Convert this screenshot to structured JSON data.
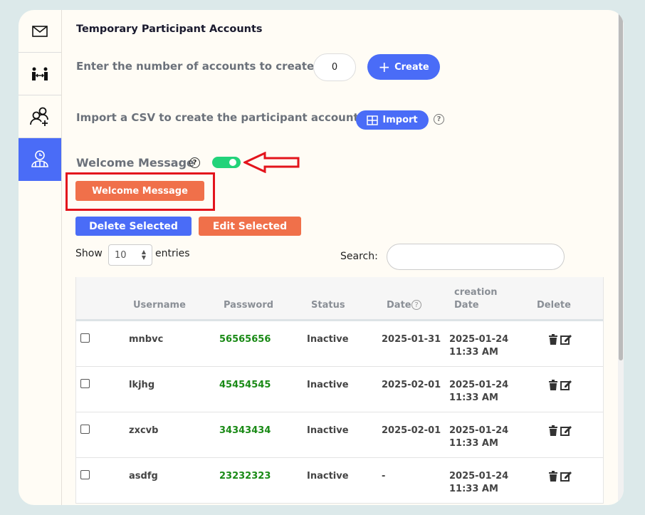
{
  "sidebar": {
    "items": [
      {
        "icon": "mail-icon"
      },
      {
        "icon": "people-exchange-icon"
      },
      {
        "icon": "add-user-icon"
      },
      {
        "icon": "clock-group-icon",
        "active": true
      }
    ]
  },
  "title": "Temporary Participant Accounts",
  "create": {
    "label": "Enter the number of accounts to create",
    "value": "0",
    "button": "Create"
  },
  "import": {
    "label": "Import a CSV to create the participant account.",
    "button": "Import"
  },
  "welcome": {
    "label": "Welcome Message",
    "toggle_on": true,
    "button": "Welcome Message"
  },
  "actions": {
    "delete": "Delete Selected",
    "edit": "Edit Selected"
  },
  "entries": {
    "show": "Show",
    "value": "10",
    "suffix": "entries"
  },
  "search": {
    "label": "Search:",
    "value": ""
  },
  "table": {
    "headers": {
      "username": "Username",
      "password": "Password",
      "status": "Status",
      "date": "Date",
      "creation1": "creation",
      "creation2": "Date",
      "delete": "Delete"
    },
    "rows": [
      {
        "username": "mnbvc",
        "password": "56565656",
        "status": "Inactive",
        "date": "2025-01-31",
        "created_date": "2025-01-24",
        "created_time": "11:33 AM"
      },
      {
        "username": "lkjhg",
        "password": "45454545",
        "status": "Inactive",
        "date": "2025-02-01",
        "created_date": "2025-01-24",
        "created_time": "11:33 AM"
      },
      {
        "username": "zxcvb",
        "password": "34343434",
        "status": "Inactive",
        "date": "2025-02-01",
        "created_date": "2025-01-24",
        "created_time": "11:33 AM"
      },
      {
        "username": "asdfg",
        "password": "23232323",
        "status": "Inactive",
        "date": "-",
        "created_date": "2025-01-24",
        "created_time": "11:33 AM"
      }
    ]
  },
  "colors": {
    "accent": "#4a6cf7",
    "orange": "#f0704a",
    "toggle": "#22d37a",
    "highlight": "#e3141c",
    "password": "#1a8a16"
  }
}
